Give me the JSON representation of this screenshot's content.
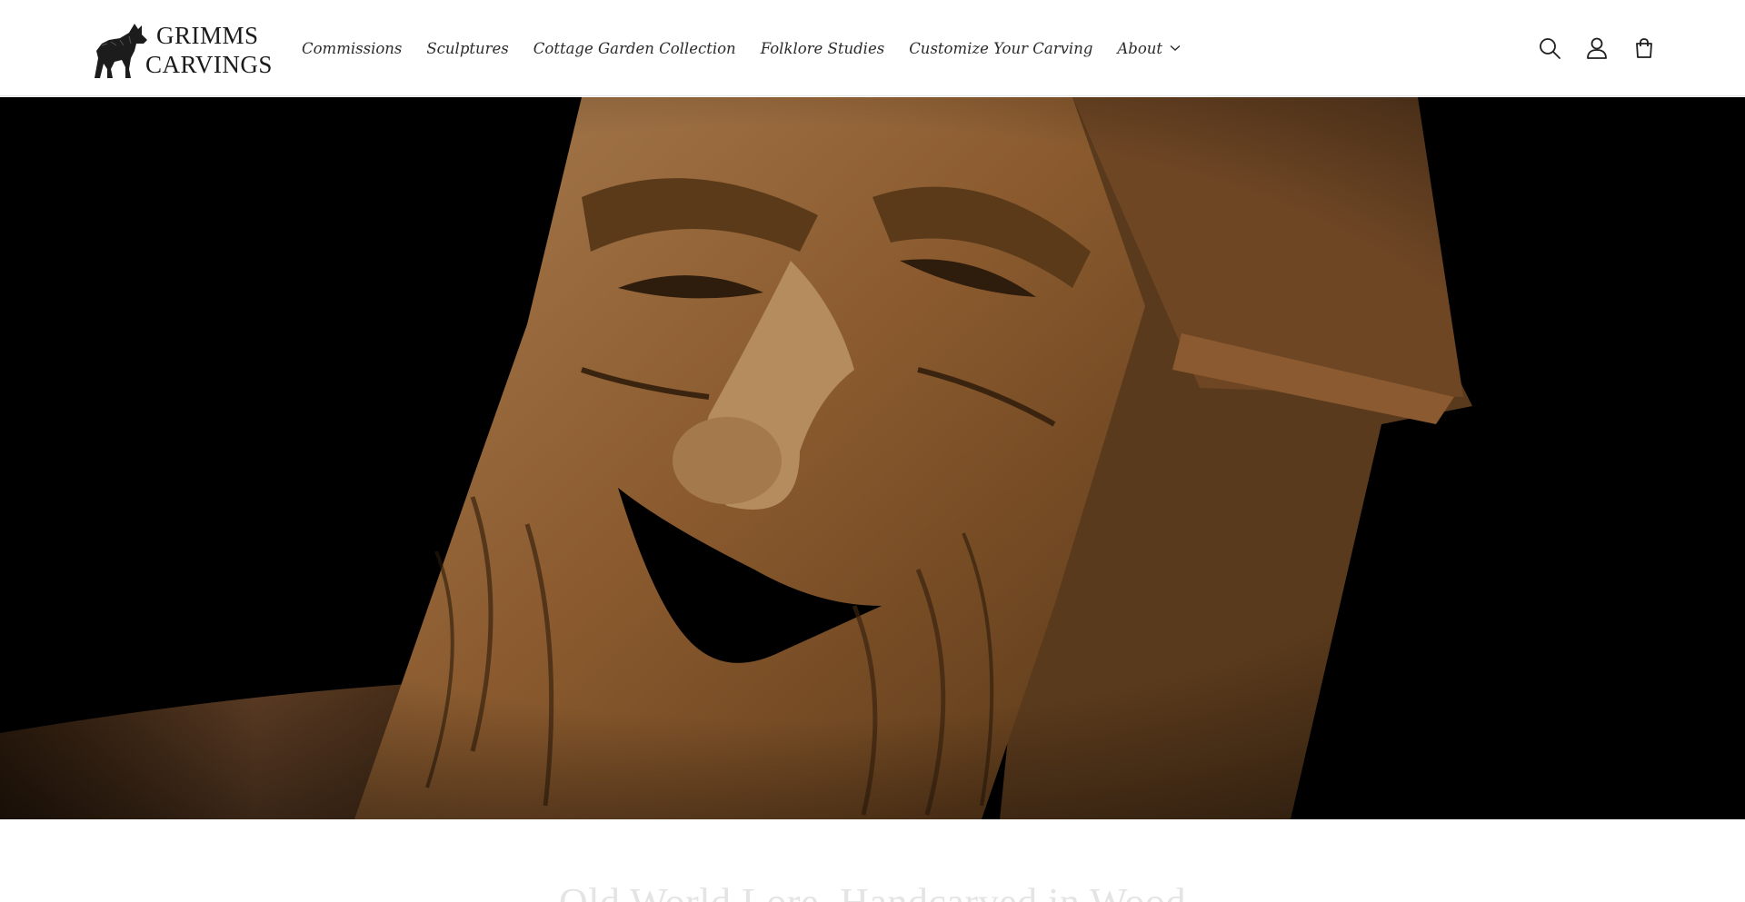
{
  "brand": {
    "line1": "GRIMMS",
    "line2": "CARVINGS",
    "logo_icon": "wolf-icon"
  },
  "nav": {
    "items": [
      {
        "label": "Commissions"
      },
      {
        "label": "Sculptures"
      },
      {
        "label": "Cottage Garden Collection"
      },
      {
        "label": "Folklore Studies"
      },
      {
        "label": "Customize Your Carving"
      },
      {
        "label": "About",
        "has_dropdown": true
      }
    ]
  },
  "header_icons": [
    "search-icon",
    "account-icon",
    "cart-icon"
  ],
  "hero": {
    "image_subject": "carved wooden face birdhouse",
    "background": "#000000",
    "wood_color": "#8a5a2e"
  },
  "section": {
    "heading": "Old World Lore, Handcarved in Wood"
  }
}
